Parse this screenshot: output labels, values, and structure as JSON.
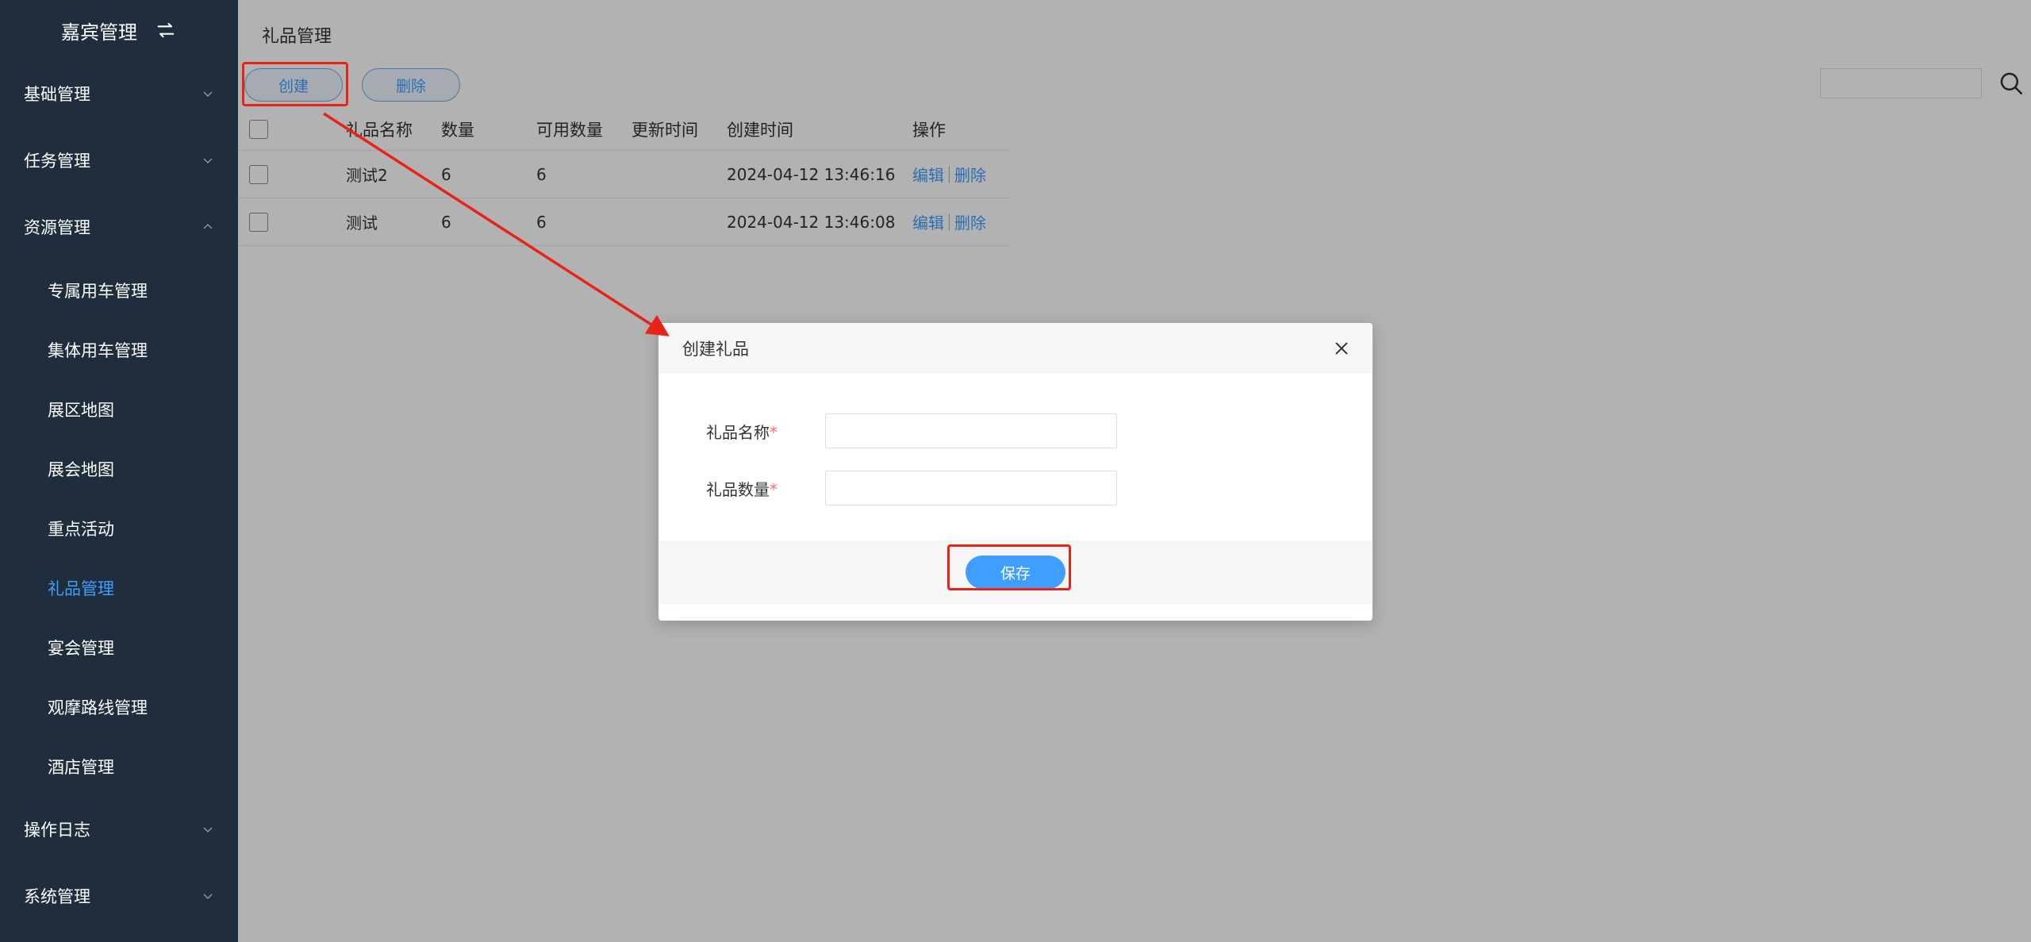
{
  "sidebar": {
    "title": "嘉宾管理",
    "groups": [
      {
        "label": "基础管理",
        "expanded": false
      },
      {
        "label": "任务管理",
        "expanded": false
      },
      {
        "label": "资源管理",
        "expanded": true
      }
    ],
    "submenu": [
      {
        "label": "专属用车管理"
      },
      {
        "label": "集体用车管理"
      },
      {
        "label": "展区地图"
      },
      {
        "label": "展会地图"
      },
      {
        "label": "重点活动"
      },
      {
        "label": "礼品管理",
        "active": true
      },
      {
        "label": "宴会管理"
      },
      {
        "label": "观摩路线管理"
      },
      {
        "label": "酒店管理"
      }
    ],
    "bottom_groups": [
      {
        "label": "操作日志"
      },
      {
        "label": "系统管理"
      }
    ]
  },
  "main": {
    "page_title": "礼品管理",
    "create_button": "创建",
    "delete_button": "删除",
    "search": {
      "value": "",
      "placeholder": ""
    },
    "table": {
      "headers": [
        "礼品名称",
        "数量",
        "可用数量",
        "更新时间",
        "创建时间",
        "操作"
      ],
      "rows": [
        {
          "name": "测试2",
          "qty": "6",
          "avail": "6",
          "updated": "",
          "created": "2024-04-12 13:46:16",
          "edit": "编辑",
          "delete": "删除"
        },
        {
          "name": "测试",
          "qty": "6",
          "avail": "6",
          "updated": "",
          "created": "2024-04-12 13:46:08",
          "edit": "编辑",
          "delete": "删除"
        }
      ]
    }
  },
  "dialog": {
    "title": "创建礼品",
    "fields": [
      {
        "label": "礼品名称",
        "required_mark": "*",
        "value": ""
      },
      {
        "label": "礼品数量",
        "required_mark": "*",
        "value": ""
      }
    ],
    "save_button": "保存"
  },
  "colors": {
    "sidebar_bg": "#1f2d3d",
    "accent": "#409eff",
    "annotation": "#e8241a",
    "required": "#f56c6c"
  }
}
